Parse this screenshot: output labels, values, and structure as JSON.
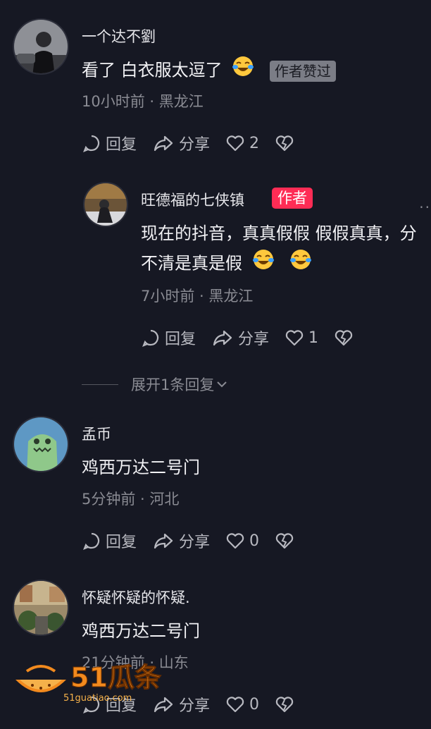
{
  "comments": [
    {
      "username": "一个达不劉",
      "text": "看了 白衣服太逗了",
      "badge": "作者赞过",
      "meta": "10小时前 · 黑龙江",
      "reply_label": "回复",
      "share_label": "分享",
      "likes": "2"
    },
    {
      "username": "旺德福的七侠镇",
      "badge": "作者",
      "text_line1": "现在的抖音，真真假假 假假真真，分",
      "text_line2": "不清是真是假",
      "meta": "7小时前 · 黑龙江",
      "reply_label": "回复",
      "share_label": "分享",
      "likes": "1"
    },
    {
      "username": "孟币",
      "text": "鸡西万达二号门",
      "meta": "5分钟前 · 河北",
      "reply_label": "回复",
      "share_label": "分享",
      "likes": "0"
    },
    {
      "username": "怀疑怀疑的怀疑.",
      "text": "鸡西万达二号门",
      "meta": "21分钟前 · 山东",
      "reply_label": "回复",
      "share_label": "分享",
      "likes": "0"
    }
  ],
  "expand_replies": "展开1条回复",
  "more_dots": "··",
  "watermark": {
    "brand": "51瓜条",
    "url": "51guatiao.com"
  },
  "colors": {
    "background": "#161823",
    "author_badge": "#fe2c55",
    "meta": "#8a8b93"
  }
}
